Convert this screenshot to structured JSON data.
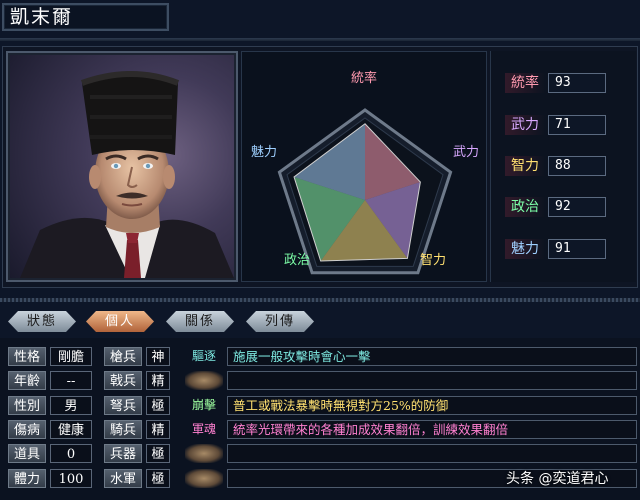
{
  "character": {
    "name": "凱末爾"
  },
  "radar": {
    "labels": {
      "top": "統率",
      "right": "武力",
      "bottom_right": "智力",
      "bottom_left": "政治",
      "left": "魅力"
    },
    "stat_values": [
      93,
      71,
      88,
      92,
      91
    ],
    "max": 100
  },
  "stats": [
    {
      "label": "統率",
      "value": "93",
      "color": "#ff9ab0"
    },
    {
      "label": "武力",
      "value": "71",
      "color": "#d8a8ff"
    },
    {
      "label": "智力",
      "value": "88",
      "color": "#ffe070"
    },
    {
      "label": "政治",
      "value": "92",
      "color": "#7dffa8"
    },
    {
      "label": "魅力",
      "value": "91",
      "color": "#9fd0ff"
    }
  ],
  "tabs": [
    {
      "label": "狀態",
      "active": false
    },
    {
      "label": "個人",
      "active": true
    },
    {
      "label": "關係",
      "active": false
    },
    {
      "label": "列傳",
      "active": false
    }
  ],
  "personal": [
    {
      "label": "性格",
      "value": "剛膽"
    },
    {
      "label": "年齡",
      "value": "--"
    },
    {
      "label": "性別",
      "value": "男"
    },
    {
      "label": "傷病",
      "value": "健康"
    },
    {
      "label": "道具",
      "value": "0"
    },
    {
      "label": "體力",
      "value": "100"
    }
  ],
  "aptitudes": [
    {
      "label": "槍兵",
      "value": "神"
    },
    {
      "label": "戟兵",
      "value": "精"
    },
    {
      "label": "弩兵",
      "value": "極"
    },
    {
      "label": "騎兵",
      "value": "精"
    },
    {
      "label": "兵器",
      "value": "極"
    },
    {
      "label": "水軍",
      "value": "極"
    }
  ],
  "skills": [
    {
      "name": "驅逐",
      "desc": "施展一般攻擊時會心一擊",
      "name_color": "#7de8e0",
      "desc_color": "#7de8e0"
    },
    {
      "name": "",
      "desc": "",
      "name_color": "",
      "desc_color": ""
    },
    {
      "name": "崩擊",
      "desc": "普工或戰法暴擊時無視對方25%的防御",
      "name_color": "#9effa0",
      "desc_color": "#ffe070"
    },
    {
      "name": "軍魂",
      "desc": "統率光環帶來的各種加成效果翻倍，訓練效果翻倍",
      "name_color": "#ff80d0",
      "desc_color": "#ff80d0"
    },
    {
      "name": "",
      "desc": "",
      "name_color": "",
      "desc_color": ""
    },
    {
      "name": "",
      "desc": "",
      "name_color": "",
      "desc_color": ""
    }
  ],
  "watermark": "头条 @奕道君心"
}
